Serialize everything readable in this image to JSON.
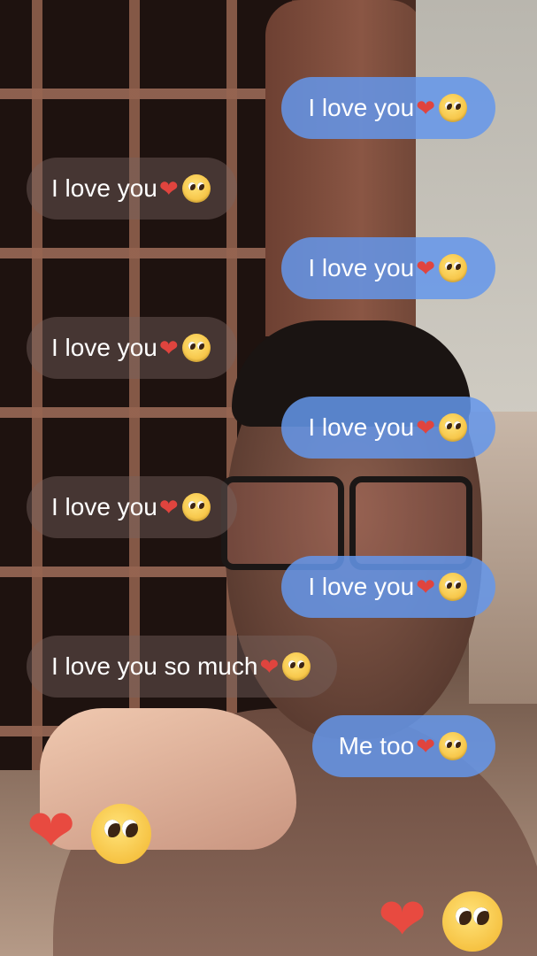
{
  "messages": [
    {
      "side": "sent",
      "text": "I love you"
    },
    {
      "side": "received",
      "text": "I love you"
    },
    {
      "side": "sent",
      "text": "I love you"
    },
    {
      "side": "received",
      "text": "I love you"
    },
    {
      "side": "sent",
      "text": "I love you"
    },
    {
      "side": "received",
      "text": "I love you"
    },
    {
      "side": "sent",
      "text": "I love you"
    },
    {
      "side": "received",
      "text": "I love you so much"
    },
    {
      "side": "sent",
      "text": "Me too"
    }
  ],
  "emoji": {
    "heart": "❤",
    "pleading_face_icon": "pleading-face",
    "heart_color": "#e0443e"
  },
  "colors": {
    "sent_bubble": "#6496eb",
    "received_bubble": "#786460"
  }
}
